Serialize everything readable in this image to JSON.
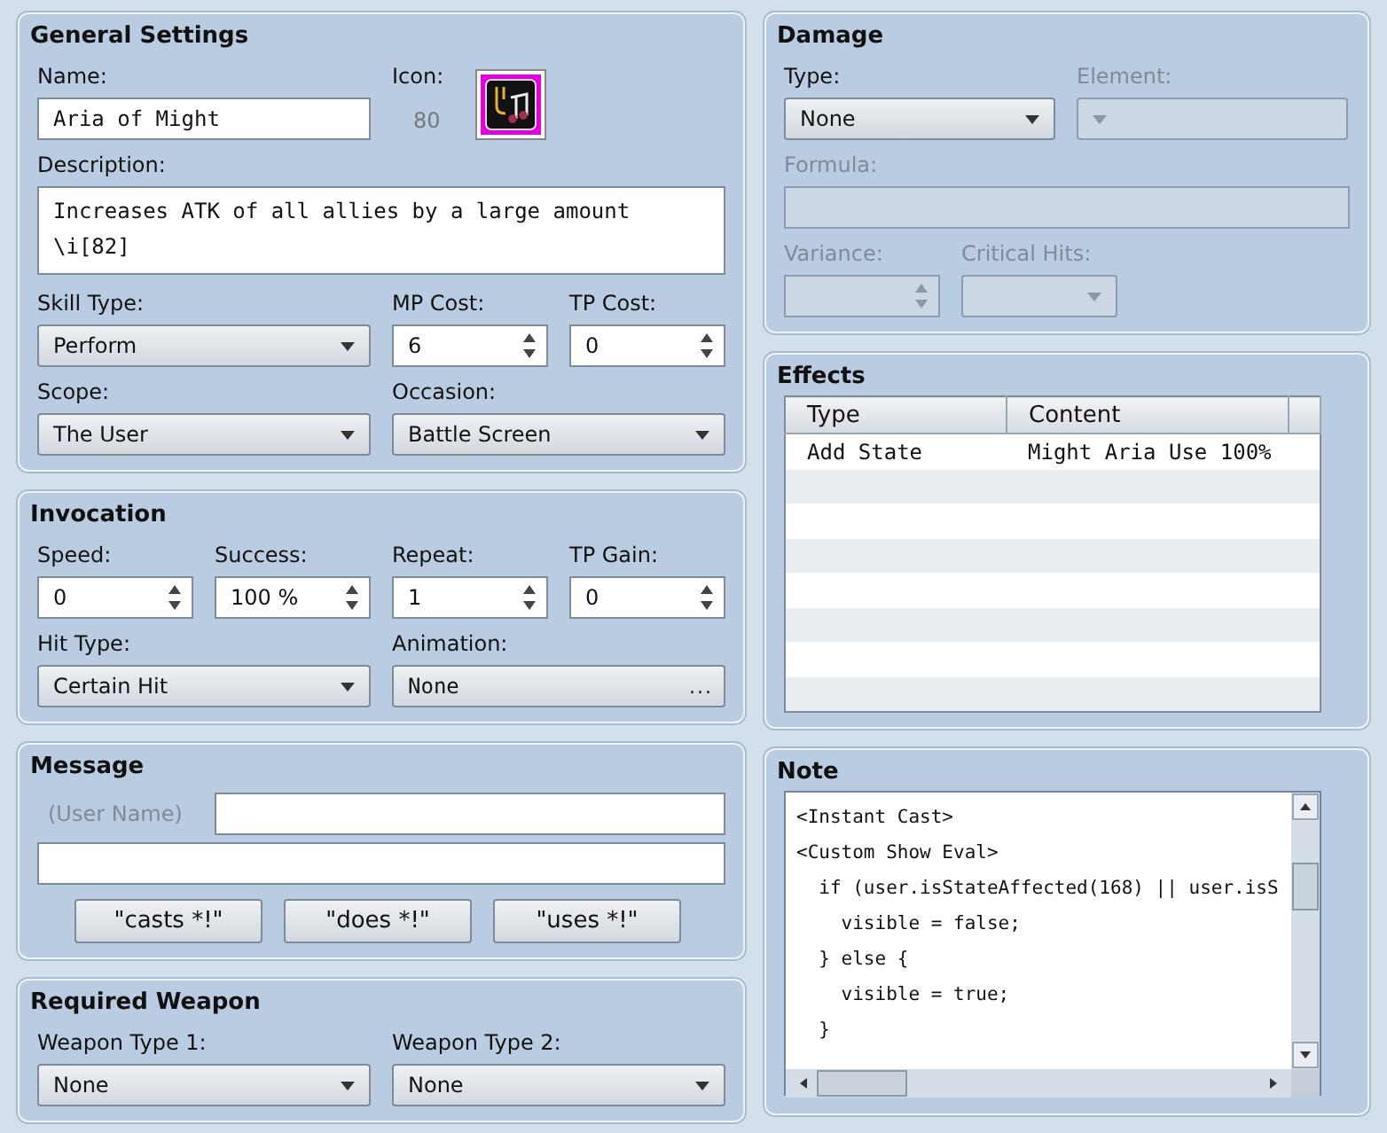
{
  "general": {
    "title": "General Settings",
    "name": {
      "label": "Name:",
      "value": "Aria of Might"
    },
    "icon": {
      "label": "Icon:",
      "index": "80"
    },
    "description": {
      "label": "Description:",
      "lines": [
        "Increases ATK of all allies by a large amount",
        "\\i[82]"
      ]
    },
    "fields": [
      {
        "label": "Skill Type:",
        "kind": "select",
        "value": "Perform"
      },
      {
        "label": "MP Cost:",
        "kind": "spin",
        "value": "6"
      },
      {
        "label": "TP Cost:",
        "kind": "spin",
        "value": "0"
      },
      {
        "label": "Scope:",
        "kind": "select",
        "value": "The User"
      },
      {
        "label": "Occasion:",
        "kind": "select",
        "value": "Battle Screen"
      }
    ]
  },
  "invocation": {
    "title": "Invocation",
    "fields": [
      {
        "label": "Speed:",
        "kind": "spin",
        "value": "0"
      },
      {
        "label": "Success:",
        "kind": "spin",
        "value": "100 %"
      },
      {
        "label": "Repeat:",
        "kind": "spin",
        "value": "1"
      },
      {
        "label": "TP Gain:",
        "kind": "spin",
        "value": "0"
      },
      {
        "label": "Hit Type:",
        "kind": "select",
        "value": "Certain Hit"
      },
      {
        "label": "Animation:",
        "kind": "picker",
        "value": "None",
        "button": "..."
      }
    ]
  },
  "message": {
    "title": "Message",
    "user_label": "(User Name)",
    "buttons": [
      "\"casts *!\"",
      "\"does *!\"",
      "\"uses *!\""
    ]
  },
  "required_weapon": {
    "title": "Required Weapon",
    "fields": [
      {
        "label": "Weapon Type 1:",
        "kind": "select",
        "value": "None"
      },
      {
        "label": "Weapon Type 2:",
        "kind": "select",
        "value": "None"
      }
    ]
  },
  "damage": {
    "title": "Damage",
    "type": {
      "label": "Type:",
      "value": "None",
      "disabled": false
    },
    "element": {
      "label": "Element:",
      "disabled": true
    },
    "formula": {
      "label": "Formula:",
      "disabled": true
    },
    "variance": {
      "label": "Variance:",
      "disabled": true
    },
    "critical_hits": {
      "label": "Critical Hits:",
      "disabled": true
    }
  },
  "effects": {
    "title": "Effects",
    "columns": [
      "Type",
      "Content"
    ],
    "rows": [
      {
        "type": "Add State",
        "content": "Might Aria Use 100%"
      }
    ]
  },
  "note": {
    "title": "Note",
    "lines": [
      "<Instant Cast>",
      "<Custom Show Eval>",
      "  if (user.isStateAffected(168) || user.isS",
      "    visible = false;",
      "  } else {",
      "    visible = true;",
      "  }"
    ]
  }
}
